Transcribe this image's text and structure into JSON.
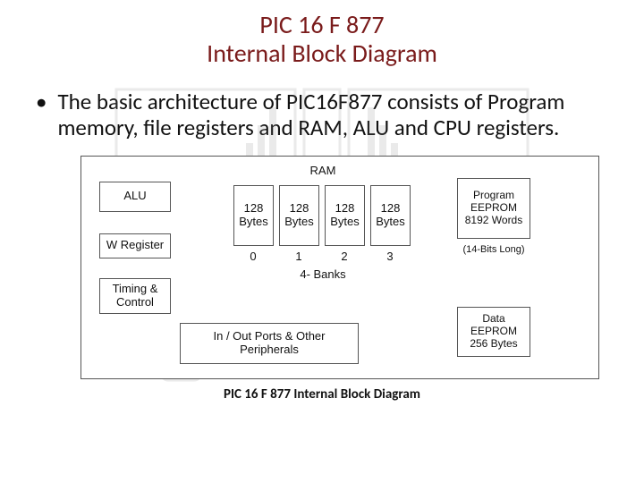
{
  "title1": "PIC 16 F 877",
  "title2": "Internal Block Diagram",
  "bullet": "The basic architecture of PIC16F877 consists of Program memory, file registers and RAM, ALU and CPU registers.",
  "diagram": {
    "alu": "ALU",
    "wreg": "W Register",
    "timing": "Timing & Control",
    "ram_label": "RAM",
    "bank_bytes": "128 Bytes",
    "bank_nums": [
      "0",
      "1",
      "2",
      "3"
    ],
    "banks_label": "4- Banks",
    "prog_eeprom": "Program EEPROM 8192 Words",
    "prog_bits": "(14-Bits Long)",
    "peripherals": "In / Out Ports & Other Peripherals",
    "data_eeprom": "Data EEPROM 256 Bytes"
  },
  "caption": "PIC 16 F 877 Internal Block Diagram"
}
